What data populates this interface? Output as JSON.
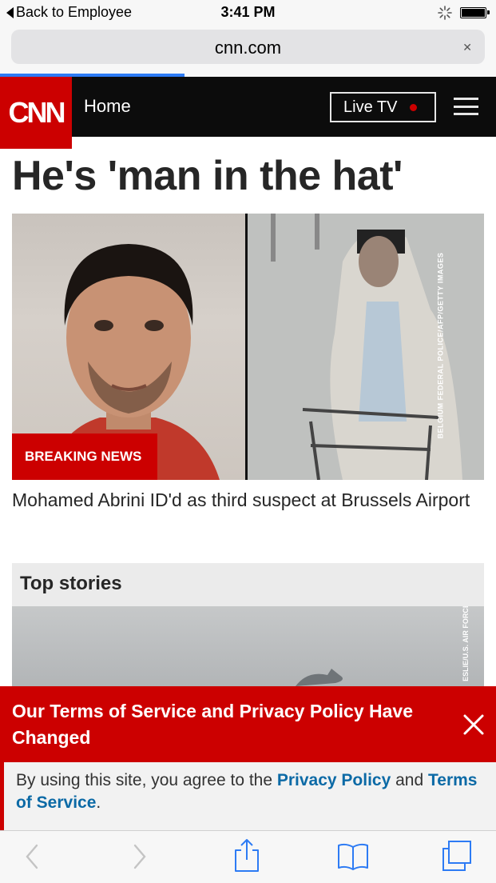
{
  "status": {
    "back_label": "Back to Employee",
    "time": "3:41 PM"
  },
  "browser": {
    "url": "cnn.com"
  },
  "header": {
    "logo": "CNN",
    "nav_home": "Home",
    "live_tv": "Live TV"
  },
  "article": {
    "headline": "He's 'man in the hat'",
    "badge": "BREAKING NEWS",
    "photo_credit": "BELGIUM FEDERAL POLICE/AFP/GETTY IMAGES",
    "caption": "Mohamed Abrini ID'd as third suspect at Brussels Airport"
  },
  "top_stories": {
    "title": "Top stories",
    "photo_credit": "ESLIE/U.S. AIR FORCE"
  },
  "banner": {
    "title": "Our Terms of Service and Privacy Policy Have Changed",
    "body_prefix": "By using this site, you agree to the ",
    "privacy_link": "Privacy Policy",
    "and_text": " and ",
    "terms_link": "Terms of Service",
    "suffix": "."
  },
  "colors": {
    "brand_red": "#cc0000",
    "link_blue": "#0c6aa6",
    "progress_blue": "#2d7bf4"
  },
  "icons": [
    "back-chevron-icon",
    "forward-chevron-icon",
    "share-icon",
    "bookmarks-icon",
    "tabs-icon",
    "close-icon",
    "menu-icon",
    "activity-spinner-icon",
    "battery-icon"
  ]
}
